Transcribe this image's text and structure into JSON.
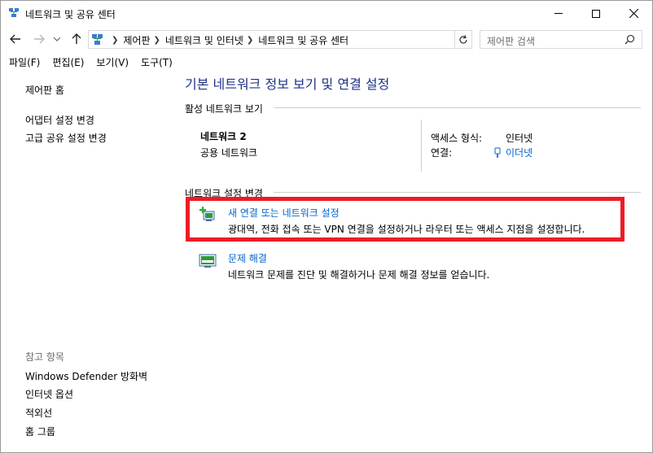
{
  "window": {
    "title": "네트워크 및 공유 센터"
  },
  "address": {
    "crumbs": [
      "제어판",
      "네트워크 및 인터넷",
      "네트워크 및 공유 센터"
    ],
    "search_placeholder": "제어판 검색"
  },
  "menu": [
    "파일(F)",
    "편집(E)",
    "보기(V)",
    "도구(T)"
  ],
  "left": {
    "home": "제어판 홈",
    "links": [
      "어댑터 설정 변경",
      "고급 공유 설정 변경"
    ],
    "see_also_heading": "참고 항목",
    "see_also": [
      "Windows Defender 방화벽",
      "인터넷 옵션",
      "적외선",
      "홈 그룹"
    ]
  },
  "main": {
    "title": "기본 네트워크 정보 보기 및 연결 설정",
    "active_label": "활성 네트워크 보기",
    "network": {
      "name": "네트워크 2",
      "type": "공용 네트워크",
      "access_type_label": "액세스 형식:",
      "access_type_value": "인터넷",
      "connection_label": "연결:",
      "connection_value": "이더넷"
    },
    "change_label": "네트워크 설정 변경",
    "tasks": [
      {
        "title": "새 연결 또는 네트워크 설정",
        "desc": "광대역, 전화 접속 또는 VPN 연결을 설정하거나 라우터 또는 액세스 지점을 설정합니다."
      },
      {
        "title": "문제 해결",
        "desc": "네트워크 문제를 진단 및 해결하거나 문제 해결 정보를 얻습니다."
      }
    ]
  },
  "colors": {
    "link": "#0066cc",
    "title": "#1e3287",
    "highlight": "#ee1c25"
  }
}
